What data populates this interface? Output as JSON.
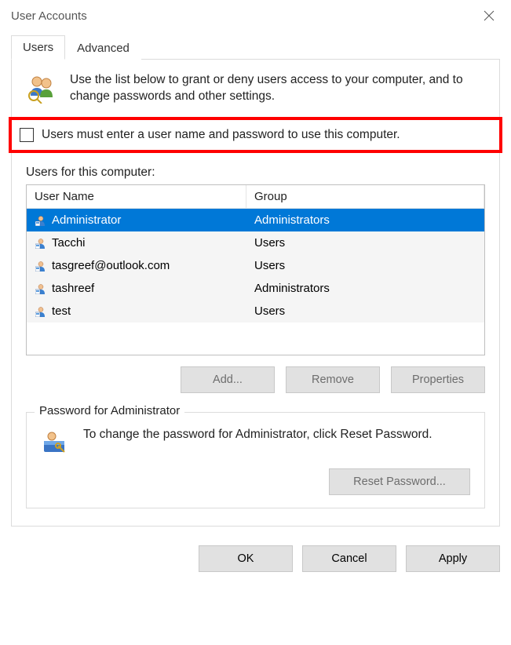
{
  "window": {
    "title": "User Accounts"
  },
  "tabs": {
    "users": "Users",
    "advanced": "Advanced"
  },
  "intro": "Use the list below to grant or deny users access to your computer, and to change passwords and other settings.",
  "checkbox_label": "Users must enter a user name and password to use this computer.",
  "list_label": "Users for this computer:",
  "columns": {
    "name": "User Name",
    "group": "Group"
  },
  "users_list": [
    {
      "name": "Administrator",
      "group": "Administrators",
      "selected": true
    },
    {
      "name": "Tacchi",
      "group": "Users",
      "selected": false
    },
    {
      "name": "tasgreef@outlook.com",
      "group": "Users",
      "selected": false
    },
    {
      "name": "tashreef",
      "group": "Administrators",
      "selected": false
    },
    {
      "name": "test",
      "group": "Users",
      "selected": false
    }
  ],
  "buttons": {
    "add": "Add...",
    "remove": "Remove",
    "properties": "Properties"
  },
  "password_box": {
    "legend": "Password for Administrator",
    "text": "To change the password for Administrator, click Reset Password.",
    "button": "Reset Password..."
  },
  "footer": {
    "ok": "OK",
    "cancel": "Cancel",
    "apply": "Apply"
  }
}
